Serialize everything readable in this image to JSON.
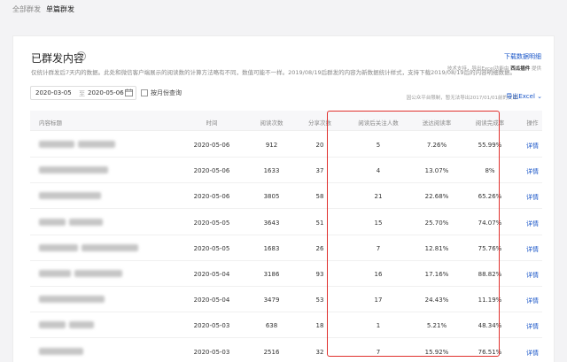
{
  "topnav": {
    "tabs": [
      {
        "label": "全部群发"
      },
      {
        "label": "单篇群发"
      }
    ]
  },
  "card": {
    "title": "已群发内容",
    "help_icon": "?",
    "download_link": "下载数据明细",
    "desc": "仅统计群发后7天内的数据。此处和微信客户端展示的阅读数的计算方法略有不同，数值可能不一样。2019/08/19后群发的内容为新数据统计样式，支持下载2019/08/19后的内容明细数据。",
    "right_note": {
      "prefix": "技术支持，导出Excel功能由 ",
      "plugin": "西瓜插件",
      "suffix": " 提供"
    },
    "date_range": {
      "start": "2020-03-05",
      "sep": "至",
      "end": "2020-05-06"
    },
    "month_query_label": "按月份查询",
    "export_note": "因公众平台限制，暂无法导出2017/01/01前的文章",
    "export_link": "导出Excel ⌄"
  },
  "table": {
    "headers": [
      "内容标题",
      "时间",
      "阅读次数",
      "分享次数",
      "阅读后关注人数",
      "送达阅读率",
      "阅读完成率",
      "操作"
    ],
    "rows": [
      {
        "time": "2020-05-06",
        "reads": "912",
        "shares": "20",
        "follows": "5",
        "rate": "7.26%",
        "completion": "55.99%",
        "op": "详情"
      },
      {
        "time": "2020-05-06",
        "reads": "1633",
        "shares": "37",
        "follows": "4",
        "rate": "13.07%",
        "completion": "8%",
        "op": "详情"
      },
      {
        "time": "2020-05-06",
        "reads": "3805",
        "shares": "58",
        "follows": "21",
        "rate": "22.68%",
        "completion": "65.26%",
        "op": "详情"
      },
      {
        "time": "2020-05-05",
        "reads": "3643",
        "shares": "51",
        "follows": "15",
        "rate": "25.70%",
        "completion": "74.07%",
        "op": "详情"
      },
      {
        "time": "2020-05-05",
        "reads": "1683",
        "shares": "26",
        "follows": "7",
        "rate": "12.81%",
        "completion": "75.76%",
        "op": "详情"
      },
      {
        "time": "2020-05-04",
        "reads": "3186",
        "shares": "93",
        "follows": "16",
        "rate": "17.16%",
        "completion": "88.82%",
        "op": "详情"
      },
      {
        "time": "2020-05-04",
        "reads": "3479",
        "shares": "53",
        "follows": "17",
        "rate": "24.43%",
        "completion": "11.19%",
        "op": "详情"
      },
      {
        "time": "2020-05-03",
        "reads": "638",
        "shares": "18",
        "follows": "1",
        "rate": "5.21%",
        "completion": "48.34%",
        "op": "详情"
      },
      {
        "time": "2020-05-03",
        "reads": "2516",
        "shares": "32",
        "follows": "7",
        "rate": "15.92%",
        "completion": "76.51%",
        "op": "详情"
      }
    ]
  },
  "colors": {
    "link": "#1a56c8",
    "highlight": "#e0302d"
  }
}
